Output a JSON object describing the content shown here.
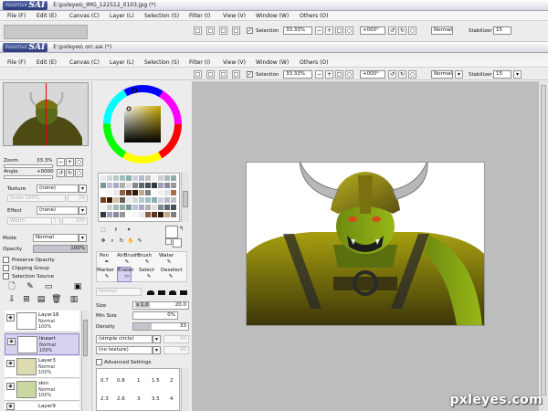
{
  "back_window": {
    "title": "E:\\pxleyes\\_IMG_122512_0103.jpg (*)",
    "menu": [
      "File (F)",
      "Edit (E)",
      "Canvas (C)",
      "Layer (L)",
      "Selection (S)",
      "Filter (I)",
      "View (V)",
      "Window (W)",
      "Others (O)"
    ],
    "selection_label": "Selection",
    "zoom": "33.33%",
    "rotation": "+000°",
    "blend": "Normal",
    "stabilizer_label": "Stabilizer",
    "stabilizer": "15"
  },
  "front_window": {
    "logo_small": "PaintTool",
    "logo_big": "SAI",
    "title": "E:\\pxleyes\\ orc.sai (*)",
    "menu": [
      "File (F)",
      "Edit (E)",
      "Canvas (C)",
      "Layer (L)",
      "Selection (S)",
      "Filter (I)",
      "View (V)",
      "Window (W)",
      "Others (O)"
    ],
    "selection_label": "Selection",
    "zoom": "33.33%",
    "rotation": "+000°",
    "blend": "Normal",
    "stabilizer_label": "Stabilizer",
    "stabilizer": "15"
  },
  "navigator": {
    "zoom_label": "Zoom",
    "zoom_value": "33.3%",
    "angle_label": "Angle",
    "angle_value": "+0000"
  },
  "layer_props": {
    "texture_label": "Texture",
    "texture_value": "(none)",
    "scale_label": "Scale",
    "scale_value": "100%",
    "scale_num": "20",
    "effect_label": "Effect",
    "effect_value": "(none)",
    "width_label": "Width",
    "width_num": "1",
    "width_max": "100",
    "mode_label": "Mode",
    "mode_value": "Normal",
    "opacity_label": "Opacity",
    "opacity_value": "100%",
    "opacity_fraction": 1.0,
    "preserve_opacity": "Preserve Opacity",
    "clipping_group": "Clipping Group",
    "selection_source": "Selection Source"
  },
  "layers": [
    {
      "name": "Layer18",
      "mode": "Normal",
      "opacity": "100%",
      "selected": false
    },
    {
      "name": "lineart",
      "mode": "Normal",
      "opacity": "100%",
      "selected": true
    },
    {
      "name": "Layer3",
      "mode": "Normal",
      "opacity": "100%",
      "selected": false
    },
    {
      "name": "skin",
      "mode": "Normal",
      "opacity": "100%",
      "selected": false
    },
    {
      "name": "Layer9",
      "mode": "",
      "opacity": "",
      "selected": false
    }
  ],
  "tools": {
    "row1": [
      "Pen",
      "AirBrush",
      "Brush",
      "Water"
    ],
    "row2": [
      "Marker",
      "Eraser",
      "Select",
      "Deselect"
    ],
    "mode_value": "Normal",
    "size_label": "Size",
    "size_mult": "x 1.0",
    "size_value": "20.0",
    "min_size_label": "Min Size",
    "min_size_value": "0%",
    "density_label": "Density",
    "density_value": "33",
    "density_fraction": 0.33,
    "shape_value": "(simple circle)",
    "shape_num": "50",
    "texture_value": "(no texture)",
    "texture_num": "95",
    "advanced_settings": "Advanced Settings",
    "sizes_row1": [
      "0.7",
      "0.8",
      "1",
      "1.5",
      "2"
    ],
    "sizes_row2": [
      "2.3",
      "2.6",
      "3",
      "3.5",
      "4"
    ]
  },
  "watermark": "pxleyes.com",
  "colors": {
    "accent": "#8c84c8",
    "canvas_bg": "#bdbdbd"
  }
}
